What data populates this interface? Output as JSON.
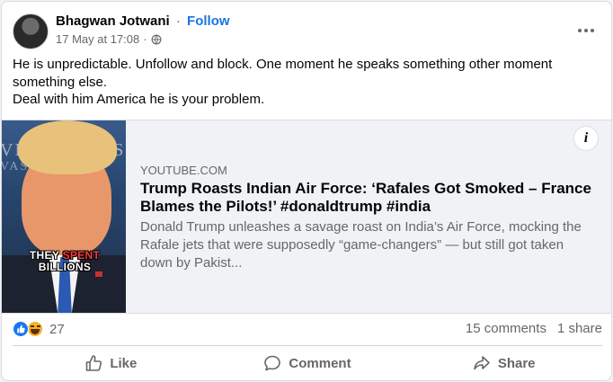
{
  "post": {
    "author": "Bhagwan Jotwani",
    "separator": "·",
    "follow_label": "Follow",
    "timestamp": "17 May at 17:08",
    "meta_dot": "·",
    "privacy_icon": "globe-icon",
    "more_icon": "more-options-icon",
    "text_lines": [
      "He is unpredictable. Unfollow and block. One moment he speaks something other moment something else.",
      "Deal with him America he is your problem."
    ]
  },
  "link_preview": {
    "thumbnail_caption_1": "THEY",
    "thumbnail_caption_red": "SPENT",
    "thumbnail_caption_2": "BILLIONS",
    "domain": "YOUTUBE.COM",
    "title": "Trump Roasts Indian Air Force: ‘Rafales Got Smoked – France Blames the Pilots!’ #donaldtrump #india",
    "description": "Donald Trump unleashes a savage roast on India’s Air Force, mocking the Rafale jets that were supposedly “game-changers” — but still got taken down by Pakist...",
    "info_label": "i"
  },
  "stats": {
    "reaction_icons": [
      "like-reaction-icon",
      "haha-reaction-icon"
    ],
    "reaction_count": "27",
    "comments": "15 comments",
    "shares": "1 share"
  },
  "actions": {
    "like": "Like",
    "comment": "Comment",
    "share": "Share"
  },
  "colors": {
    "accent": "#1b74e4",
    "like_blue": "#1877f2",
    "secondary_text": "#65676b",
    "haha_yellow": "#f7b125"
  }
}
